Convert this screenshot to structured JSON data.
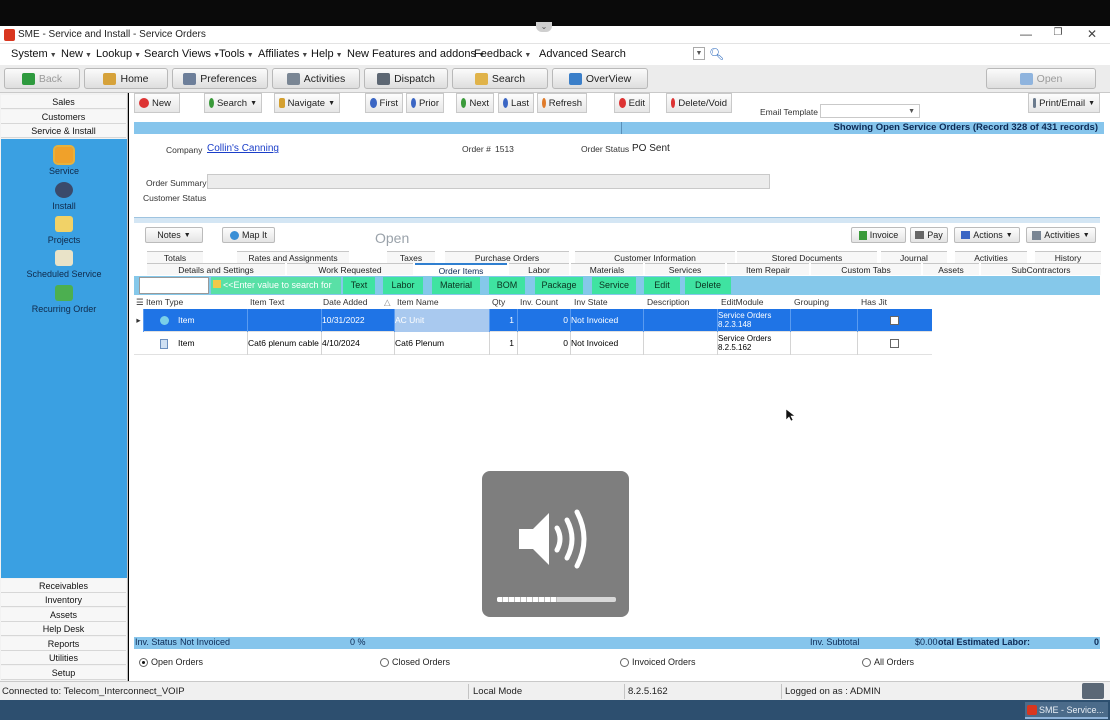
{
  "window": {
    "title": "SME - Service and Install - Service Orders"
  },
  "menu": {
    "items": [
      "System",
      "New",
      "Lookup",
      "Search Views",
      "Tools",
      "Affiliates",
      "Help",
      "New Features and addons",
      "Feedback",
      "Advanced Search"
    ]
  },
  "nav": {
    "back": "Back",
    "home": "Home",
    "preferences": "Preferences",
    "activities": "Activities",
    "dispatch": "Dispatch",
    "search": "Search",
    "overview": "OverView",
    "open": "Open"
  },
  "sidebar": {
    "top_tabs": [
      "Sales",
      "Customers",
      "Service & Install"
    ],
    "icons": [
      "Service",
      "Install",
      "Projects",
      "Scheduled Service",
      "Recurring Order"
    ],
    "bottom_tabs": [
      "Receivables",
      "Inventory",
      "Assets",
      "Help Desk",
      "Reports",
      "Utilities",
      "Setup"
    ]
  },
  "commands": {
    "new": "New",
    "search": "Search",
    "navigate": "Navigate",
    "first": "First",
    "prior": "Prior",
    "next": "Next",
    "last": "Last",
    "refresh": "Refresh",
    "edit": "Edit",
    "delete_void": "Delete/Void",
    "email_template_label": "Email Template",
    "email_template_value": "",
    "print_email": "Print/Email"
  },
  "status_banner": "Showing Open Service Orders   (Record 328 of 431 records)",
  "order": {
    "company_label": "Company",
    "company": "Collin's Canning",
    "order_num_label": "Order #",
    "order_num": "1513",
    "order_status_label": "Order Status",
    "order_status": "PO Sent",
    "summary_label": "Order Summary",
    "summary_value": "",
    "customer_status_label": "Customer Status"
  },
  "detail_buttons": {
    "notes": "Notes",
    "map_it": "Map It",
    "state": "Open",
    "invoice": "Invoice",
    "pay": "Pay",
    "actions": "Actions",
    "activities": "Activities"
  },
  "tabs_row1": [
    "Totals",
    "Rates and Assignments",
    "Taxes",
    "Purchase Orders",
    "Customer Information",
    "Stored Documents",
    "Journal",
    "Activities",
    "History"
  ],
  "tabs_row2": [
    "Details and Settings",
    "Work Requested",
    "Order Items",
    "Labor",
    "Materials",
    "Services",
    "Item Repair",
    "Custom Tabs",
    "Assets",
    "SubContractors"
  ],
  "itembar": {
    "filter_placeholder": "<<Enter value to search for",
    "buttons": [
      "Text",
      "Labor",
      "Material",
      "BOM",
      "Package",
      "Service",
      "Edit",
      "Delete"
    ]
  },
  "grid": {
    "headers": [
      "Item Type",
      "Item Text",
      "Date Added",
      "Item Name",
      "Qty",
      "Inv. Count",
      "Inv State",
      "Description",
      "EditModule",
      "Grouping",
      "Has Jit"
    ],
    "rows": [
      {
        "type": "Item",
        "text": "",
        "date": "10/31/2022",
        "name": "AC Unit",
        "qty": "1",
        "inv_count": "0",
        "inv_state": "Not Invoiced",
        "description": "",
        "edit_module": "Service Orders 8.2.3.148",
        "grouping": "",
        "has_jit": false
      },
      {
        "type": "Item",
        "text": "Cat6 plenum cable",
        "date": "4/10/2024",
        "name": "Cat6 Plenum",
        "qty": "1",
        "inv_count": "0",
        "inv_state": "Not Invoiced",
        "description": "",
        "edit_module": "Service Orders 8.2.5.162",
        "grouping": "",
        "has_jit": false
      }
    ]
  },
  "footer": {
    "inv_status_label": "Inv. Status",
    "inv_status": "Not Invoiced",
    "percent": "0 %",
    "subtotal_label": "Inv. Subtotal",
    "subtotal": "$0.00",
    "labor_label": "otal Estimated Labor:",
    "labor": "0"
  },
  "filters": [
    "Open Orders",
    "Closed Orders",
    "Invoiced Orders",
    "All Orders"
  ],
  "volume": {
    "level": 0.5
  },
  "statusbar": {
    "connection": "Connected to: Telecom_Interconnect_VOIP",
    "mode": "Local Mode",
    "version": "8.2.5.162",
    "user": "Logged on as : ADMIN"
  },
  "taskbar": {
    "task": "SME - Service..."
  },
  "colors": {
    "accent": "#3aa0e2",
    "selection": "#1f74e6",
    "strip": "#86c5ec",
    "green_button": "#3fe3a1"
  }
}
